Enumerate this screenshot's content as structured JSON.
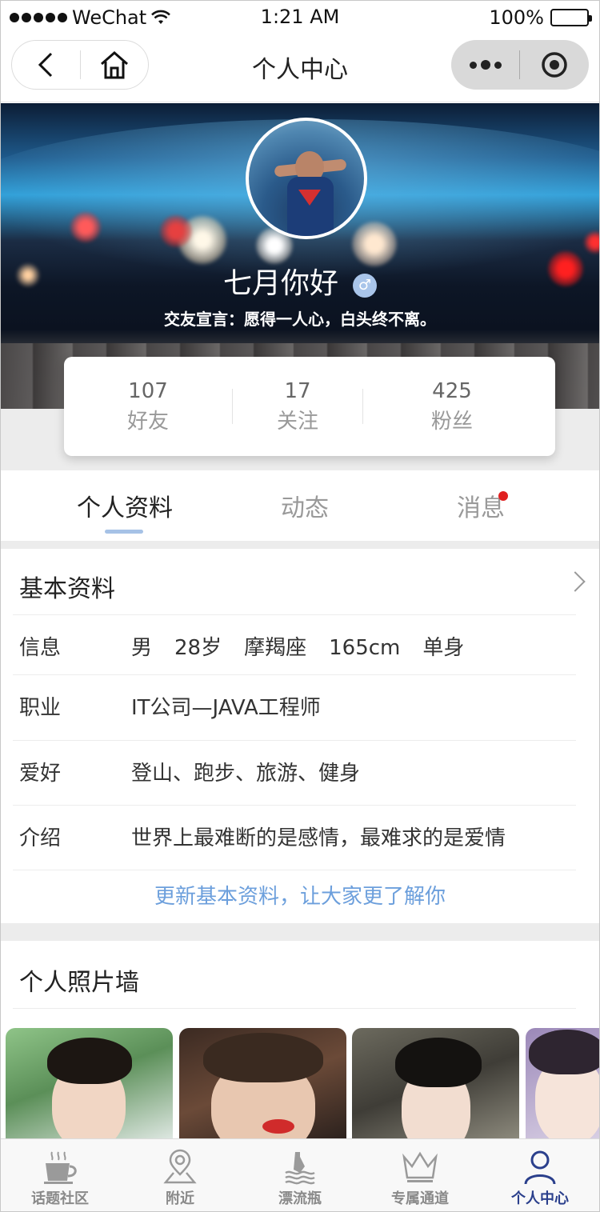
{
  "status_bar": {
    "carrier": "WeChat",
    "time": "1:21 AM",
    "battery": "100%",
    "battery_level": 1.0
  },
  "nav": {
    "title": "个人中心",
    "back_icon": "chevron-left-icon",
    "home_icon": "home-icon",
    "more_icon": "more-dots-icon",
    "close_icon": "record-circle-icon"
  },
  "profile": {
    "username": "七月你好",
    "gender_symbol": "♂",
    "motto": "交友宣言：愿得一人心，白头终不离。",
    "stats": [
      {
        "value": "107",
        "label": "好友"
      },
      {
        "value": "17",
        "label": "关注"
      },
      {
        "value": "425",
        "label": "粉丝"
      }
    ]
  },
  "tabs": [
    {
      "label": "个人资料",
      "active": true
    },
    {
      "label": "动态",
      "active": false
    },
    {
      "label": "消息",
      "active": false,
      "badge": true
    }
  ],
  "basic_info": {
    "title": "基本资料",
    "rows": [
      {
        "label": "信息",
        "values": [
          "男",
          "28岁",
          "摩羯座",
          "165cm",
          "单身"
        ]
      },
      {
        "label": "职业",
        "values": [
          "IT公司—JAVA工程师"
        ]
      },
      {
        "label": "爱好",
        "values": [
          "登山、跑步、旅游、健身"
        ]
      },
      {
        "label": "介绍",
        "values": [
          "世界上最难断的是感情，最难求的是爱情"
        ]
      }
    ],
    "update_link": "更新基本资料，让大家更了解你"
  },
  "photo_wall": {
    "title": "个人照片墙"
  },
  "tabbar": [
    {
      "label": "话题社区",
      "icon": "coffee-cup-icon",
      "active": false
    },
    {
      "label": "附近",
      "icon": "location-pin-icon",
      "active": false
    },
    {
      "label": "漂流瓶",
      "icon": "bottle-waves-icon",
      "active": false
    },
    {
      "label": "专属通道",
      "icon": "crown-icon",
      "active": false
    },
    {
      "label": "个人中心",
      "icon": "user-icon",
      "active": true
    }
  ],
  "colors": {
    "accent_blue": "#6c9fdc",
    "tab_underline": "#a6c2e6",
    "badge_red": "#e02020",
    "tabbar_active": "#2a3f8c"
  }
}
